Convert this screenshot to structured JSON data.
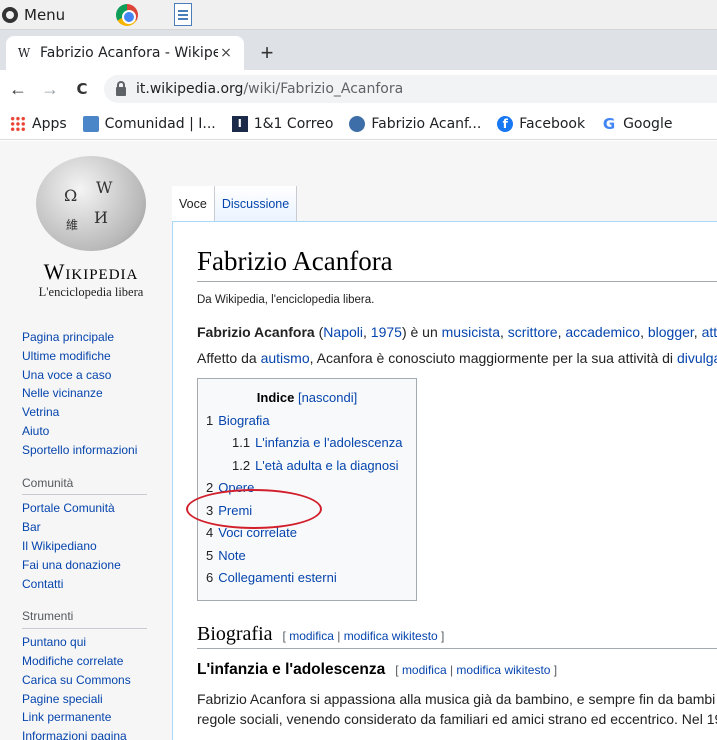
{
  "taskbar": {
    "menu_label": "Menu"
  },
  "tab": {
    "favicon": "W",
    "title": "Fabrizio Acanfora - Wikipe",
    "close": "×",
    "new_tab": "+"
  },
  "toolbar": {
    "back": "←",
    "forward": "→",
    "reload": "C",
    "url_host": "it.wikipedia.org",
    "url_path": "/wiki/Fabrizio_Acanfora"
  },
  "bookmarks": [
    {
      "label": "Apps",
      "icon": "apps-grid-icon"
    },
    {
      "label": "Comunidad | I...",
      "icon": "comunidad-icon"
    },
    {
      "label": "1&1 Correo",
      "icon": "correo-icon"
    },
    {
      "label": "Fabrizio Acanf...",
      "icon": "wikipedia-icon"
    },
    {
      "label": "Facebook",
      "icon": "facebook-icon"
    },
    {
      "label": "Google",
      "icon": "google-icon"
    }
  ],
  "logo": {
    "wordmark": "Wikipedia",
    "tagline": "L'enciclopedia libera"
  },
  "nav": {
    "main": [
      "Pagina principale",
      "Ultime modifiche",
      "Una voce a caso",
      "Nelle vicinanze",
      "Vetrina",
      "Aiuto",
      "Sportello informazioni"
    ],
    "community_heading": "Comunità",
    "community": [
      "Portale Comunità",
      "Bar",
      "Il Wikipediano",
      "Fai una donazione",
      "Contatti"
    ],
    "tools_heading": "Strumenti",
    "tools": [
      "Puntano qui",
      "Modifiche correlate",
      "Carica su Commons",
      "Pagine speciali",
      "Link permanente",
      "Informazioni pagina"
    ]
  },
  "page_tabs": [
    "Voce",
    "Discussione"
  ],
  "article": {
    "title": "Fabrizio Acanfora",
    "site_sub": "Da Wikipedia, l'enciclopedia libera.",
    "p1": {
      "bold": "Fabrizio Acanfora",
      "t1": " (",
      "l1": "Napoli",
      "t2": ", ",
      "l2": "1975",
      "t3": ") è un ",
      "l3": "musicista",
      "t4": ", ",
      "l4": "scrittore",
      "t5": ", ",
      "l5": "accademico",
      "t6": ", ",
      "l6": "blogger",
      "t7": ", ",
      "l7": "att"
    },
    "p2": {
      "t1": "Affetto da ",
      "l1": "autismo",
      "t2": ", Acanfora è conosciuto maggiormente per la sua attività di ",
      "l2": "divulga"
    },
    "toc": {
      "title": "Indice",
      "toggle": "[nascondi]",
      "items": [
        {
          "num": "1",
          "label": "Biografia"
        },
        {
          "num": "1.1",
          "label": "L'infanzia e l'adolescenza"
        },
        {
          "num": "1.2",
          "label": "L'età adulta e la diagnosi"
        },
        {
          "num": "2",
          "label": "Opere"
        },
        {
          "num": "3",
          "label": "Premi"
        },
        {
          "num": "4",
          "label": "Voci correlate"
        },
        {
          "num": "5",
          "label": "Note"
        },
        {
          "num": "6",
          "label": "Collegamenti esterni"
        }
      ]
    },
    "h2": "Biografia",
    "edit": {
      "open": "[ ",
      "modifica": "modifica",
      "sep": " | ",
      "wikitesto": "modifica wikitesto",
      "close": " ]"
    },
    "h3": "L'infanzia e l'adolescenza",
    "p3": "Fabrizio Acanfora si appassiona alla musica già da bambino, e sempre fin da bambi",
    "p4": "regole sociali, venendo considerato da familiari ed amici strano ed eccentrico. Nel 19"
  },
  "annotation_color": "#d21f2c"
}
